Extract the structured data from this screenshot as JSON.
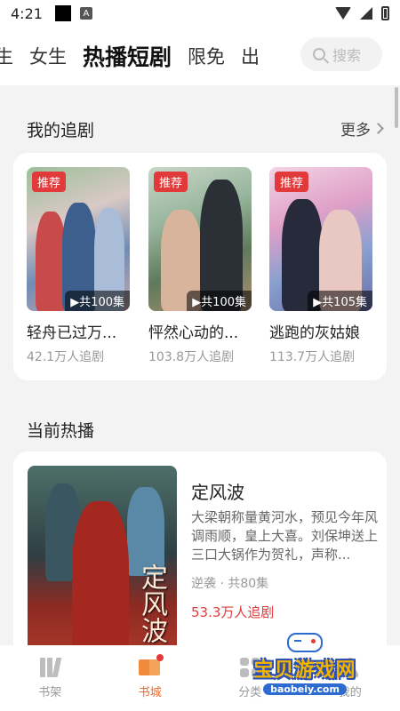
{
  "status_bar": {
    "time": "4:21",
    "a_label": "A"
  },
  "top_tabs": [
    {
      "label": "男生",
      "partial": "生"
    },
    {
      "label": "女生"
    },
    {
      "label": "热播短剧",
      "active": true
    },
    {
      "label": "限免"
    },
    {
      "label": "出版",
      "partial": "出"
    }
  ],
  "search": {
    "placeholder": "搜索"
  },
  "my_follow": {
    "title": "我的追剧",
    "more_label": "更多",
    "items": [
      {
        "title": "轻舟已过万...",
        "stat": "42.1万人追剧",
        "badge": "推荐",
        "episodes": "▶共100集"
      },
      {
        "title": "怦然心动的...",
        "stat": "103.8万人追剧",
        "badge": "推荐",
        "episodes": "▶共100集"
      },
      {
        "title": "逃跑的灰姑娘",
        "stat": "113.7万人追剧",
        "badge": "推荐",
        "episodes": "▶共105集"
      }
    ]
  },
  "current_hot": {
    "title": "当前热播",
    "drama": {
      "title": "定风波",
      "description": "大梁朝称量黄河水，预见今年风调雨顺，皇上大喜。刘保坤送上三口大锅作为贺礼，声称...",
      "meta": "逆袭 · 共80集",
      "stat": "53.3万人追剧",
      "cover_text": "定风波"
    }
  },
  "bottom_nav": [
    {
      "label": "书架",
      "icon": "bookshelf-icon"
    },
    {
      "label": "书城",
      "icon": "book-open-icon",
      "active": true
    },
    {
      "label": "分类",
      "icon": "category-icon"
    },
    {
      "label": "我的",
      "icon": "profile-icon"
    }
  ],
  "watermark": {
    "text": "宝贝游戏网",
    "url": "baobeiy.com"
  },
  "colors": {
    "accent": "#ef6a2c",
    "badge_red": "#e23a3a",
    "stat_red": "#e03c3c"
  }
}
